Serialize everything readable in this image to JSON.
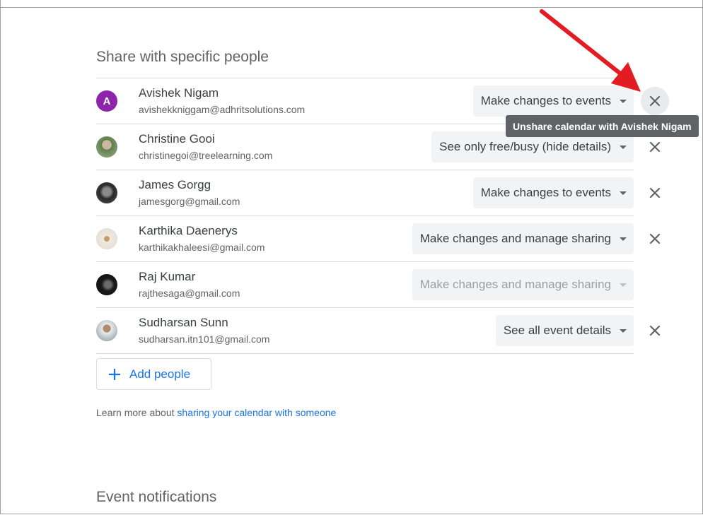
{
  "sections": {
    "share_title": "Share with specific people",
    "notifications_title": "Event notifications"
  },
  "people": [
    {
      "name": "Avishek Nigam",
      "email": "avishekkniggam@adhritsolutions.com",
      "permission": "Make changes to events",
      "avatar_letter": "A",
      "avatar_color": "#8e24aa",
      "removable": true,
      "disabled": false
    },
    {
      "name": "Christine Gooi",
      "email": "christinegoi@treelearning.com",
      "permission": "See only free/busy (hide details)",
      "avatar_color": "#6d8a5c",
      "removable": true,
      "disabled": false
    },
    {
      "name": "James Gorgg",
      "email": "jamesgorg@gmail.com",
      "permission": "Make changes to events",
      "avatar_color": "#3a3a3a",
      "removable": true,
      "disabled": false
    },
    {
      "name": "Karthika Daenerys",
      "email": "karthikakhaleesi@gmail.com",
      "permission": "Make changes and manage sharing",
      "avatar_color": "#e9e4dc",
      "removable": true,
      "disabled": false
    },
    {
      "name": "Raj Kumar",
      "email": "rajthesaga@gmail.com",
      "permission": "Make changes and manage sharing",
      "avatar_color": "#1e1e1e",
      "removable": false,
      "disabled": true
    },
    {
      "name": "Sudharsan Sunn",
      "email": "sudharsan.itn101@gmail.com",
      "permission": "See all event details",
      "avatar_color": "#7a8a90",
      "removable": true,
      "disabled": false
    }
  ],
  "tooltip": "Unshare calendar with Avishek Nigam",
  "add_people_label": "Add people",
  "learn_more": {
    "prefix": "Learn more about ",
    "link": "sharing your calendar with someone"
  },
  "icons": {
    "remove": "close-icon",
    "add": "plus-icon",
    "dropdown": "caret-down-icon"
  },
  "colors": {
    "accent": "#1a73e8",
    "annotation_arrow": "#e31b23"
  }
}
